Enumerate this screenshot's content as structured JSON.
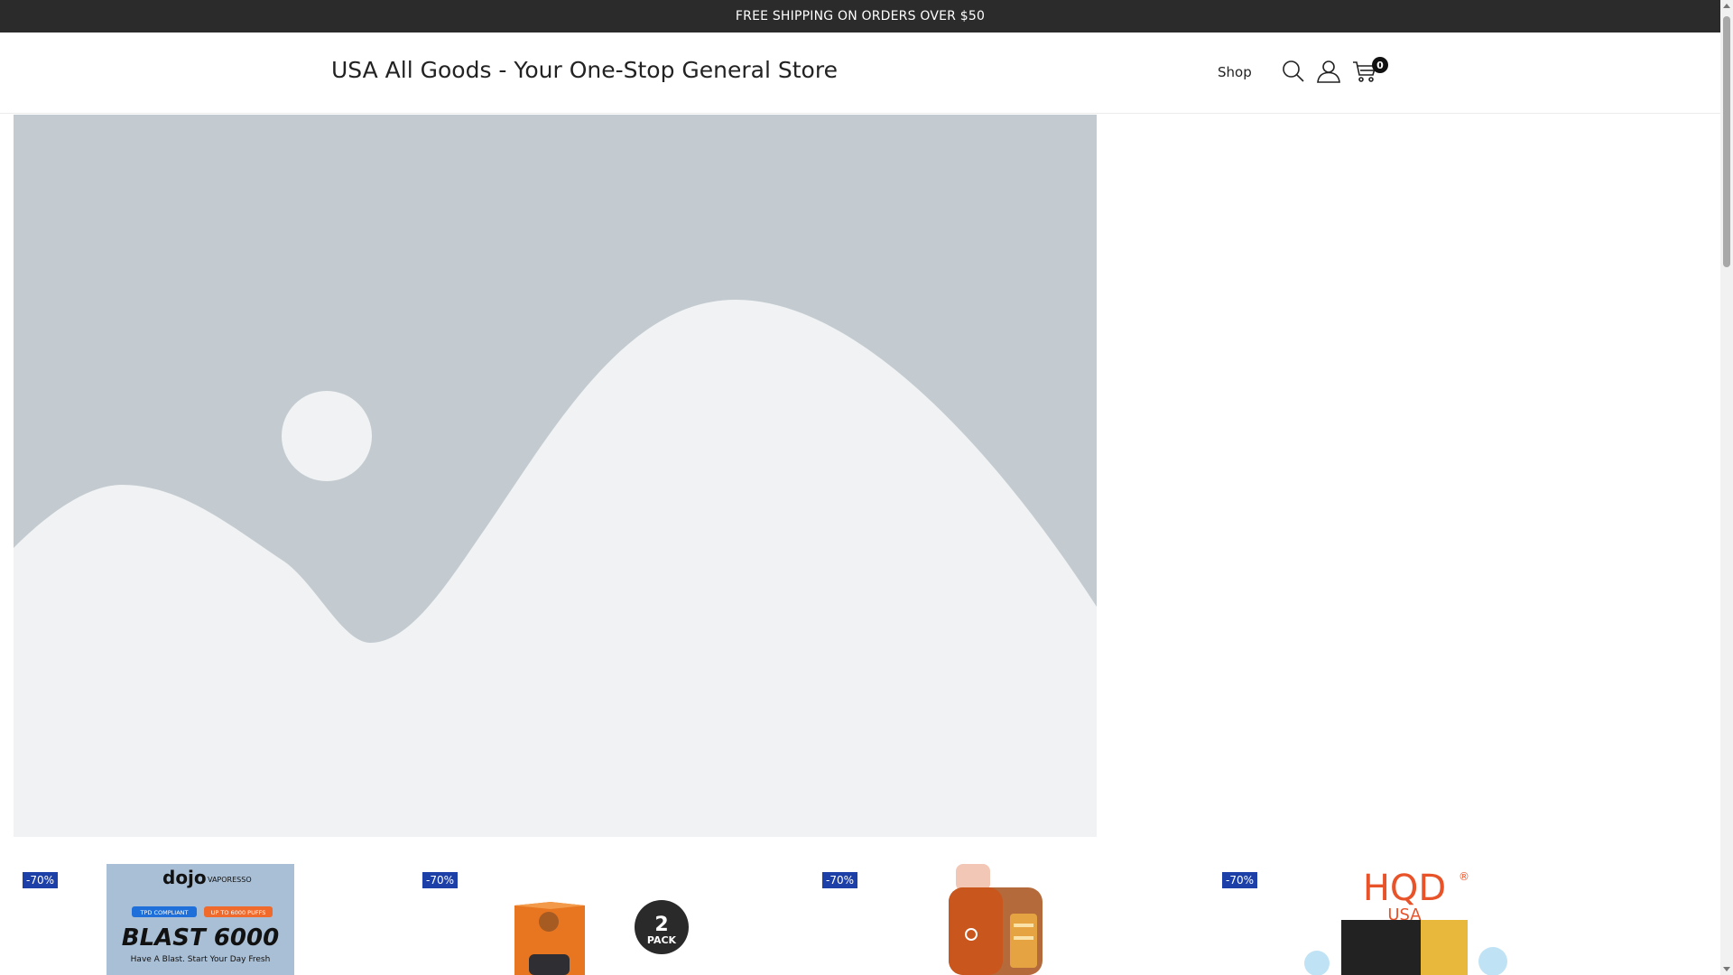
{
  "announcement": {
    "text": "FREE SHIPPING ON ORDERS OVER $50"
  },
  "header": {
    "site_title": "USA All Goods - Your One-Stop General Store",
    "nav": [
      {
        "label": "Shop"
      }
    ],
    "icons": {
      "search": "search-icon",
      "account": "user-icon",
      "cart": "cart-icon"
    },
    "cart_count": "0"
  },
  "hero": {
    "image": "placeholder-image-icon"
  },
  "products": [
    {
      "badge": "-70%",
      "image_text": {
        "brand": "dojo",
        "sub": "VAPORESSO",
        "tag1": "TPD COMPLIANT",
        "tag2": "UP TO 6000 PUFFS",
        "name": "BLAST 6000",
        "tagline": "Have A Blast. Start Your Day Fresh"
      }
    },
    {
      "badge": "-70%",
      "image_text": {
        "pack_number": "2",
        "pack_label": "PACK"
      }
    },
    {
      "badge": "-70%"
    },
    {
      "badge": "-70%",
      "image_text": {
        "brand": "HQD",
        "region": "USA",
        "mark": "®"
      }
    }
  ],
  "colors": {
    "topbar_bg": "#2b2b2b",
    "badge_bg": "#1c3fa8",
    "hero_bg": "#c3cbd1",
    "hero_fg": "#f0f2f3",
    "hqd_orange": "#e8532a"
  }
}
